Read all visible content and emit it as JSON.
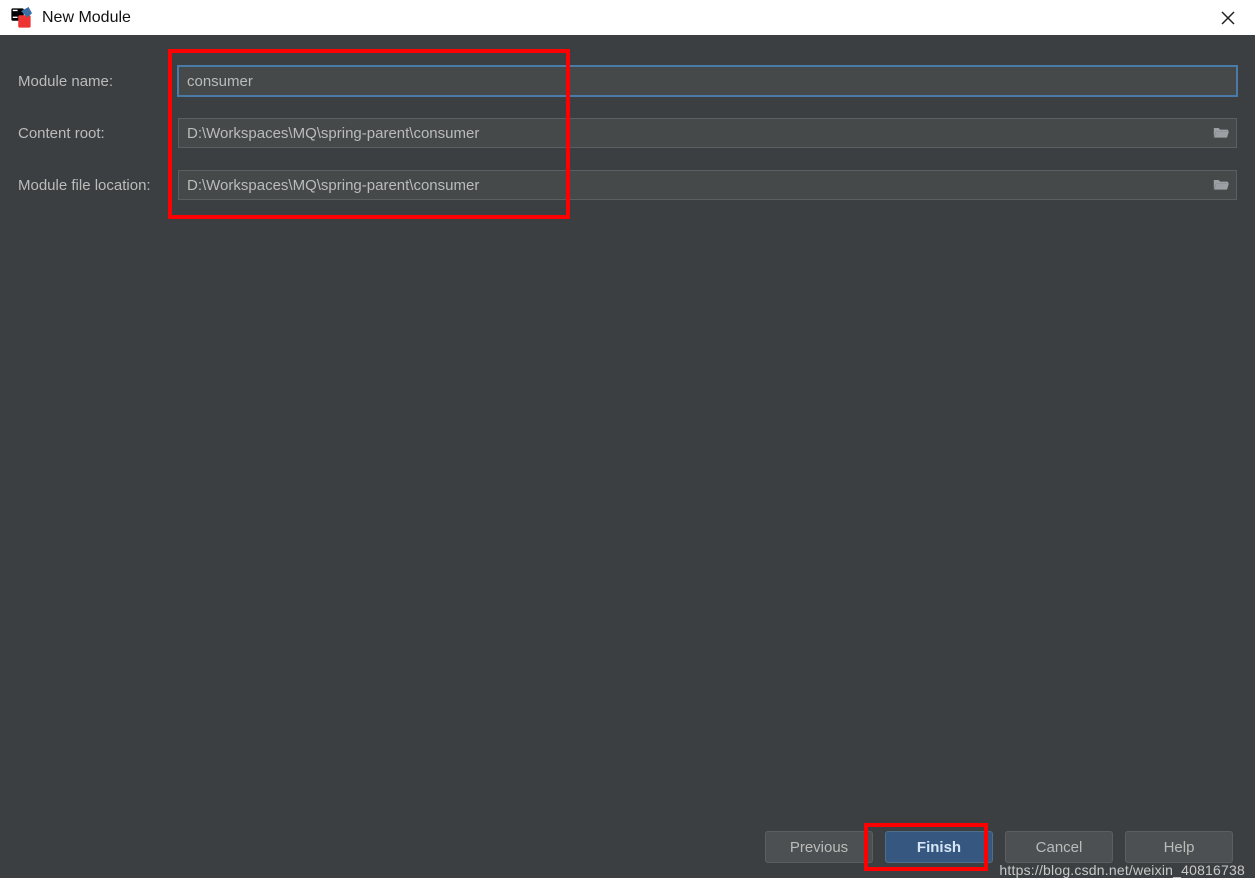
{
  "header": {
    "title": "New Module"
  },
  "form": {
    "module_name": {
      "label": "Module name:",
      "value": "consumer"
    },
    "content_root": {
      "label": "Content root:",
      "value": "D:\\Workspaces\\MQ\\spring-parent\\consumer"
    },
    "module_file_location": {
      "label": "Module file location:",
      "value": "D:\\Workspaces\\MQ\\spring-parent\\consumer"
    }
  },
  "footer": {
    "previous": "Previous",
    "finish": "Finish",
    "cancel": "Cancel",
    "help": "Help"
  },
  "watermark": "https://blog.csdn.net/weixin_40816738"
}
